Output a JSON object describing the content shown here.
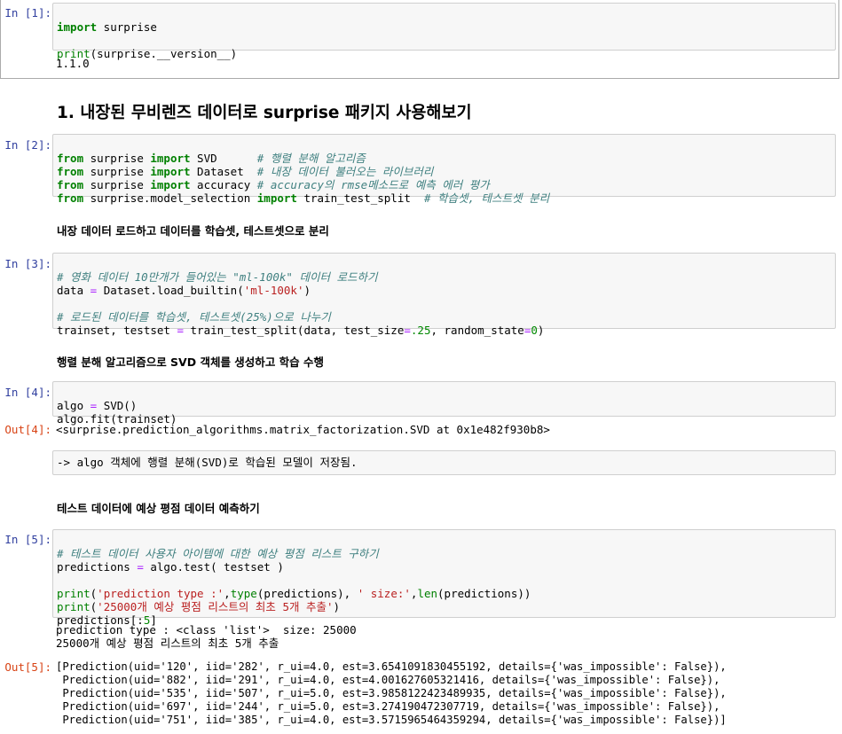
{
  "cells": {
    "c1": {
      "prompt": "In [1]:",
      "line1_kw": "import",
      "line1_rest": " surprise",
      "line3_fn": "print",
      "line3_rest": "(surprise.__version__)",
      "output": "1.1.0"
    },
    "heading1": "1. 내장된 무비렌즈 데이터로 surprise 패키지 사용해보기",
    "c2": {
      "prompt": "In [2]:",
      "lines": [
        {
          "a": "from",
          "b": " surprise ",
          "c": "import",
          "d": " SVD      ",
          "e": "# 행렬 분해 알고리즘"
        },
        {
          "a": "from",
          "b": " surprise ",
          "c": "import",
          "d": " Dataset  ",
          "e": "# 내장 데이터 불러오는 라이브러리"
        },
        {
          "a": "from",
          "b": " surprise ",
          "c": "import",
          "d": " accuracy ",
          "e": "# accuracy의 rmse메소드로 예측 에러 평가"
        },
        {
          "a": "from",
          "b": " surprise.model_selection ",
          "c": "import",
          "d": " train_test_split  ",
          "e": "# 학습셋, 테스트셋 분리"
        }
      ]
    },
    "md2": "내장 데이터 로드하고 데이터를 학습셋, 테스트셋으로 분리",
    "c3": {
      "prompt": "In [3]:",
      "l1": "# 영화 데이터 10만개가 들어있는 \"ml-100k\" 데이터 로드하기",
      "l2a": "data ",
      "l2op": "=",
      "l2b": " Dataset.load_builtin(",
      "l2s": "'ml-100k'",
      "l2c": ")",
      "l4": "# 로드된 데이터를 학습셋, 테스트셋(25%)으로 나누기",
      "l5a": "trainset, testset ",
      "l5op": "=",
      "l5b": " train_test_split(data, test_size",
      "l5op2": "=",
      "l5n": ".25",
      "l5c": ", random_state",
      "l5op3": "=",
      "l5n2": "0",
      "l5d": ")"
    },
    "md3": "행렬 분해 알고리즘으로 SVD 객체를 생성하고 학습 수행",
    "c4": {
      "prompt": "In [4]:",
      "l1a": "algo ",
      "l1op": "=",
      "l1b": " SVD()",
      "l2": "algo.fit(trainset)",
      "out_prompt": "Out[4]:",
      "output": "<surprise.prediction_algorithms.matrix_factorization.SVD at 0x1e482f930b8>"
    },
    "md4": "-> algo 객체에 행렬 분해(SVD)로 학습된 모델이 저장됨.",
    "md5": "테스트 데이터에 예상 평점 데이터 예측하기",
    "c5": {
      "prompt": "In [5]:",
      "l1": "# 테스트 데이터 사용자 아이템에 대한 예상 평점 리스트 구하기",
      "l2a": "predictions ",
      "l2op": "=",
      "l2b": " algo.test( testset )",
      "l4fn": "print",
      "l4a": "(",
      "l4s1": "'prediction type :'",
      "l4b": ",",
      "l4fn2": "type",
      "l4c": "(predictions), ",
      "l4s2": "' size:'",
      "l4d": ",",
      "l4fn3": "len",
      "l4e": "(predictions))",
      "l5fn": "print",
      "l5a": "(",
      "l5s": "'25000개 예상 평점 리스트의 최초 5개 추출'",
      "l5b": ")",
      "l6a": "predictions[:",
      "l6n": "5",
      "l6b": "]",
      "stdout1": "prediction type : <class 'list'>  size: 25000",
      "stdout2": "25000개 예상 평점 리스트의 최초 5개 추출",
      "out_prompt": "Out[5]:",
      "out_lines": [
        "[Prediction(uid='120', iid='282', r_ui=4.0, est=3.6541091830455192, details={'was_impossible': False}),",
        " Prediction(uid='882', iid='291', r_ui=4.0, est=4.001627605321416, details={'was_impossible': False}),",
        " Prediction(uid='535', iid='507', r_ui=5.0, est=3.9858122423489935, details={'was_impossible': False}),",
        " Prediction(uid='697', iid='244', r_ui=5.0, est=3.274190472307719, details={'was_impossible': False}),",
        " Prediction(uid='751', iid='385', r_ui=4.0, est=3.5715965464359294, details={'was_impossible': False})]"
      ]
    }
  }
}
